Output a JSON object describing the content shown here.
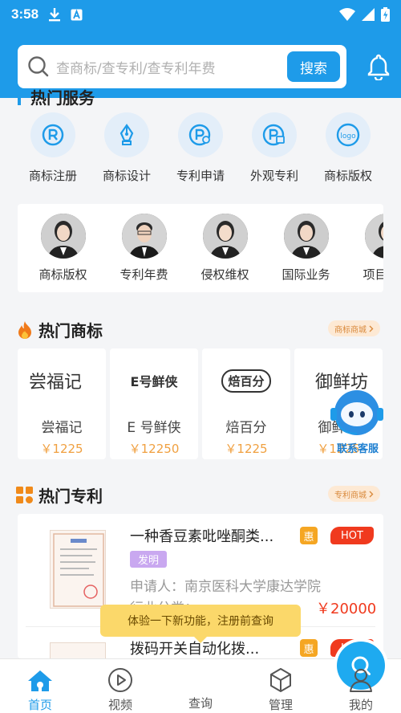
{
  "status_bar": {
    "time": "3:58"
  },
  "search": {
    "placeholder": "查商标/查专利/查专利年费",
    "button_label": "搜索"
  },
  "hot_services": {
    "title": "热门服务",
    "items": [
      {
        "label": "商标注册",
        "icon": "trademark-register-icon"
      },
      {
        "label": "商标设计",
        "icon": "pen-nib-icon"
      },
      {
        "label": "专利申请",
        "icon": "patent-apply-icon"
      },
      {
        "label": "外观专利",
        "icon": "design-patent-icon"
      },
      {
        "label": "商标版权",
        "icon": "logo-copyright-icon"
      }
    ],
    "people": [
      {
        "label": "商标版权"
      },
      {
        "label": "专利年费"
      },
      {
        "label": "侵权维权"
      },
      {
        "label": "国际业务"
      },
      {
        "label": "项目申报"
      }
    ]
  },
  "hot_trademarks": {
    "title": "热门商标",
    "more_label": "商标商城",
    "items": [
      {
        "logo_text": "尝福记",
        "name": "尝福记",
        "price": "￥1225"
      },
      {
        "logo_text": "E号鲜侠",
        "name": "E 号鲜侠",
        "price": "￥12250"
      },
      {
        "logo_text": "焙百分",
        "name": "焙百分",
        "price": "￥1225"
      },
      {
        "logo_text": "御鲜坊",
        "name": "御鲜坊",
        "price": "￥1225"
      }
    ]
  },
  "customer_service": {
    "label": "联系客服"
  },
  "hot_patents": {
    "title": "热门专利",
    "more_label": "专利商城",
    "items": [
      {
        "title": "一种香豆素吡唑酮类...",
        "hui": "惠",
        "hot": "HOT",
        "tag": "发明",
        "applicant": "申请人：南京医科大学康达学院",
        "industry": "行业分类：",
        "price": "￥20000"
      },
      {
        "title": "拨码开关自动化拨...",
        "hui": "惠",
        "hot": "HOT"
      }
    ]
  },
  "toast": {
    "text": "体验一下新功能，注册前查询"
  },
  "tabbar": {
    "items": [
      {
        "label": "首页",
        "icon": "home-icon"
      },
      {
        "label": "视频",
        "icon": "play-icon"
      },
      {
        "label": "查询",
        "icon": "search-icon"
      },
      {
        "label": "管理",
        "icon": "cube-icon"
      },
      {
        "label": "我的",
        "icon": "user-icon"
      }
    ]
  },
  "colors": {
    "primary": "#1e9be9",
    "hot": "#f03a1e",
    "price": "#f0a040",
    "hui": "#f5a623"
  }
}
